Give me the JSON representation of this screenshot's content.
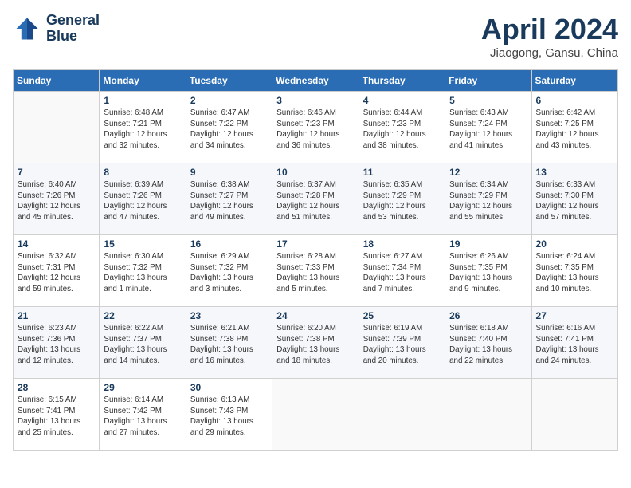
{
  "logo": {
    "line1": "General",
    "line2": "Blue"
  },
  "title": "April 2024",
  "subtitle": "Jiaogong, Gansu, China",
  "days_header": [
    "Sunday",
    "Monday",
    "Tuesday",
    "Wednesday",
    "Thursday",
    "Friday",
    "Saturday"
  ],
  "weeks": [
    [
      {
        "day": "",
        "info": ""
      },
      {
        "day": "1",
        "info": "Sunrise: 6:48 AM\nSunset: 7:21 PM\nDaylight: 12 hours\nand 32 minutes."
      },
      {
        "day": "2",
        "info": "Sunrise: 6:47 AM\nSunset: 7:22 PM\nDaylight: 12 hours\nand 34 minutes."
      },
      {
        "day": "3",
        "info": "Sunrise: 6:46 AM\nSunset: 7:23 PM\nDaylight: 12 hours\nand 36 minutes."
      },
      {
        "day": "4",
        "info": "Sunrise: 6:44 AM\nSunset: 7:23 PM\nDaylight: 12 hours\nand 38 minutes."
      },
      {
        "day": "5",
        "info": "Sunrise: 6:43 AM\nSunset: 7:24 PM\nDaylight: 12 hours\nand 41 minutes."
      },
      {
        "day": "6",
        "info": "Sunrise: 6:42 AM\nSunset: 7:25 PM\nDaylight: 12 hours\nand 43 minutes."
      }
    ],
    [
      {
        "day": "7",
        "info": "Sunrise: 6:40 AM\nSunset: 7:26 PM\nDaylight: 12 hours\nand 45 minutes."
      },
      {
        "day": "8",
        "info": "Sunrise: 6:39 AM\nSunset: 7:26 PM\nDaylight: 12 hours\nand 47 minutes."
      },
      {
        "day": "9",
        "info": "Sunrise: 6:38 AM\nSunset: 7:27 PM\nDaylight: 12 hours\nand 49 minutes."
      },
      {
        "day": "10",
        "info": "Sunrise: 6:37 AM\nSunset: 7:28 PM\nDaylight: 12 hours\nand 51 minutes."
      },
      {
        "day": "11",
        "info": "Sunrise: 6:35 AM\nSunset: 7:29 PM\nDaylight: 12 hours\nand 53 minutes."
      },
      {
        "day": "12",
        "info": "Sunrise: 6:34 AM\nSunset: 7:29 PM\nDaylight: 12 hours\nand 55 minutes."
      },
      {
        "day": "13",
        "info": "Sunrise: 6:33 AM\nSunset: 7:30 PM\nDaylight: 12 hours\nand 57 minutes."
      }
    ],
    [
      {
        "day": "14",
        "info": "Sunrise: 6:32 AM\nSunset: 7:31 PM\nDaylight: 12 hours\nand 59 minutes."
      },
      {
        "day": "15",
        "info": "Sunrise: 6:30 AM\nSunset: 7:32 PM\nDaylight: 13 hours\nand 1 minute."
      },
      {
        "day": "16",
        "info": "Sunrise: 6:29 AM\nSunset: 7:32 PM\nDaylight: 13 hours\nand 3 minutes."
      },
      {
        "day": "17",
        "info": "Sunrise: 6:28 AM\nSunset: 7:33 PM\nDaylight: 13 hours\nand 5 minutes."
      },
      {
        "day": "18",
        "info": "Sunrise: 6:27 AM\nSunset: 7:34 PM\nDaylight: 13 hours\nand 7 minutes."
      },
      {
        "day": "19",
        "info": "Sunrise: 6:26 AM\nSunset: 7:35 PM\nDaylight: 13 hours\nand 9 minutes."
      },
      {
        "day": "20",
        "info": "Sunrise: 6:24 AM\nSunset: 7:35 PM\nDaylight: 13 hours\nand 10 minutes."
      }
    ],
    [
      {
        "day": "21",
        "info": "Sunrise: 6:23 AM\nSunset: 7:36 PM\nDaylight: 13 hours\nand 12 minutes."
      },
      {
        "day": "22",
        "info": "Sunrise: 6:22 AM\nSunset: 7:37 PM\nDaylight: 13 hours\nand 14 minutes."
      },
      {
        "day": "23",
        "info": "Sunrise: 6:21 AM\nSunset: 7:38 PM\nDaylight: 13 hours\nand 16 minutes."
      },
      {
        "day": "24",
        "info": "Sunrise: 6:20 AM\nSunset: 7:38 PM\nDaylight: 13 hours\nand 18 minutes."
      },
      {
        "day": "25",
        "info": "Sunrise: 6:19 AM\nSunset: 7:39 PM\nDaylight: 13 hours\nand 20 minutes."
      },
      {
        "day": "26",
        "info": "Sunrise: 6:18 AM\nSunset: 7:40 PM\nDaylight: 13 hours\nand 22 minutes."
      },
      {
        "day": "27",
        "info": "Sunrise: 6:16 AM\nSunset: 7:41 PM\nDaylight: 13 hours\nand 24 minutes."
      }
    ],
    [
      {
        "day": "28",
        "info": "Sunrise: 6:15 AM\nSunset: 7:41 PM\nDaylight: 13 hours\nand 25 minutes."
      },
      {
        "day": "29",
        "info": "Sunrise: 6:14 AM\nSunset: 7:42 PM\nDaylight: 13 hours\nand 27 minutes."
      },
      {
        "day": "30",
        "info": "Sunrise: 6:13 AM\nSunset: 7:43 PM\nDaylight: 13 hours\nand 29 minutes."
      },
      {
        "day": "",
        "info": ""
      },
      {
        "day": "",
        "info": ""
      },
      {
        "day": "",
        "info": ""
      },
      {
        "day": "",
        "info": ""
      }
    ]
  ]
}
